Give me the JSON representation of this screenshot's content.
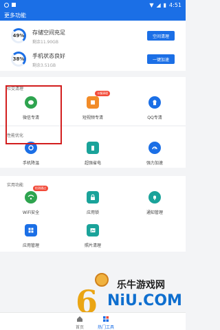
{
  "statusbar": {
    "time": "4:51"
  },
  "header": {
    "title": "更多功能"
  },
  "summary": {
    "storage": {
      "percent": "49%",
      "title": "存储空间充足",
      "subtitle": "剩余11.90GB",
      "button": "空间清理"
    },
    "phone": {
      "percent": "38%",
      "title": "手机状态良好",
      "subtitle": "剩余3.51GB",
      "button": "一键加速"
    }
  },
  "sections": {
    "clean": {
      "title": "社交清理",
      "items": [
        {
          "label": "微信专清",
          "icon": "wechat-icon"
        },
        {
          "label": "短视频专清",
          "icon": "shortvideo-icon",
          "badge": "卡慢清理"
        },
        {
          "label": "QQ专清",
          "icon": "qq-icon"
        }
      ]
    },
    "perf": {
      "title": "性能优化",
      "items": [
        {
          "label": "手机降温",
          "icon": "cooling-icon"
        },
        {
          "label": "超强省电",
          "icon": "battery-icon"
        },
        {
          "label": "强力加速",
          "icon": "speedometer-icon"
        }
      ]
    },
    "util": {
      "title": "实用功能",
      "items": [
        {
          "label": "WiFi安全",
          "icon": "wifi-icon",
          "badge": "检测通过"
        },
        {
          "label": "应用锁",
          "icon": "lock-icon"
        },
        {
          "label": "通知管理",
          "icon": "bell-icon"
        },
        {
          "label": "应用管理",
          "icon": "apps-icon"
        },
        {
          "label": "照片清理",
          "icon": "photo-icon"
        }
      ]
    }
  },
  "watermark": {
    "title": "乐牛游戏网",
    "subtitle": "NiU.COM"
  },
  "bottomnav": {
    "home": "首页",
    "tools": "热门工具"
  },
  "colors": {
    "primary": "#1b6fe6",
    "highlight": "#d21d1d"
  }
}
